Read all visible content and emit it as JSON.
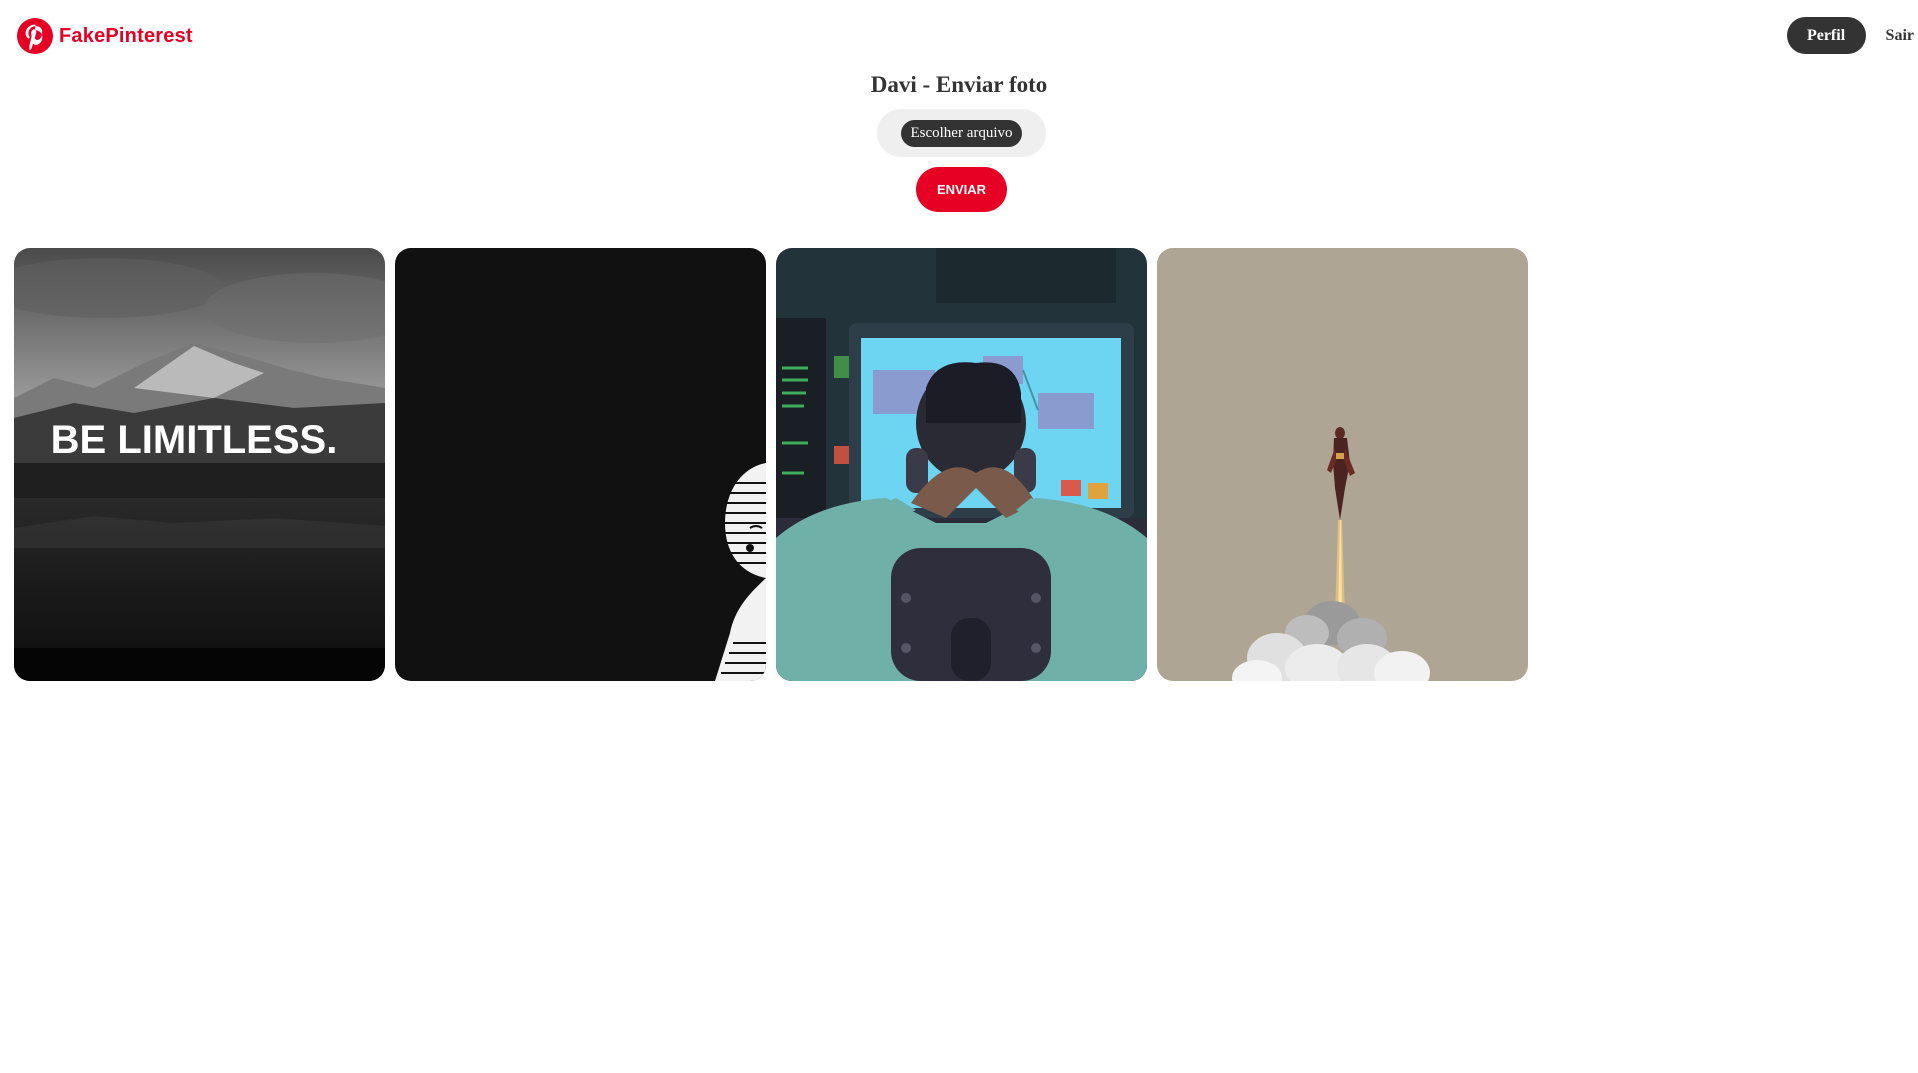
{
  "navbar": {
    "brand": "FakePinterest",
    "brand_color": "#e60023",
    "profile_label": "Perfil",
    "logout_label": "Sair"
  },
  "upload": {
    "title": "Davi - Enviar foto",
    "file_button_label": "Escolher arquivo",
    "submit_label": "ENVIAR",
    "submit_color": "#e60023"
  },
  "gallery": {
    "images": [
      {
        "name": "be-limitless",
        "caption": "BE LIMITLESS."
      },
      {
        "name": "dark-anime-peek"
      },
      {
        "name": "programmer-at-computer"
      },
      {
        "name": "rocket-flying-man"
      }
    ]
  }
}
